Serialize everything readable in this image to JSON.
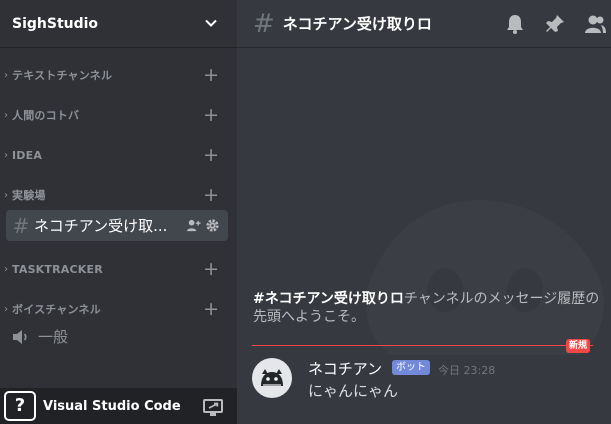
{
  "server": {
    "name": "SighStudio"
  },
  "categories": [
    {
      "name": "テキストチャンネル"
    },
    {
      "name": "人間のコトバ"
    },
    {
      "name": "IDEA"
    },
    {
      "name": "実験場"
    },
    {
      "name": "TASKTRACKER"
    },
    {
      "name": "ボイスチャンネル"
    }
  ],
  "active_channel": {
    "name": "ネコチアン受け取..."
  },
  "voice_channel": {
    "name": "一般"
  },
  "activity": {
    "icon_text": "?",
    "name": "Visual Studio Code"
  },
  "header": {
    "title": "ネコチアン受け取りロ"
  },
  "welcome": {
    "channel_bold": "#ネコチアン受け取りロ",
    "text": "チャンネルのメッセージ履歴の先頭へようこそ。"
  },
  "divider": {
    "badge": "新規"
  },
  "message": {
    "author": "ネコチアン",
    "tag": "ボット",
    "time": "今日 23:28",
    "text": "にゃんにゃん"
  },
  "icons": [
    "chevron-down-icon",
    "plus-icon",
    "add-member-icon",
    "gear-icon",
    "speaker-icon",
    "screen-share-icon",
    "bell-icon",
    "pin-icon",
    "members-icon",
    "hash-icon"
  ],
  "colors": {
    "sidebar": "#2f3136",
    "main": "#36393f",
    "accent": "#7289da",
    "new": "#f04747"
  }
}
